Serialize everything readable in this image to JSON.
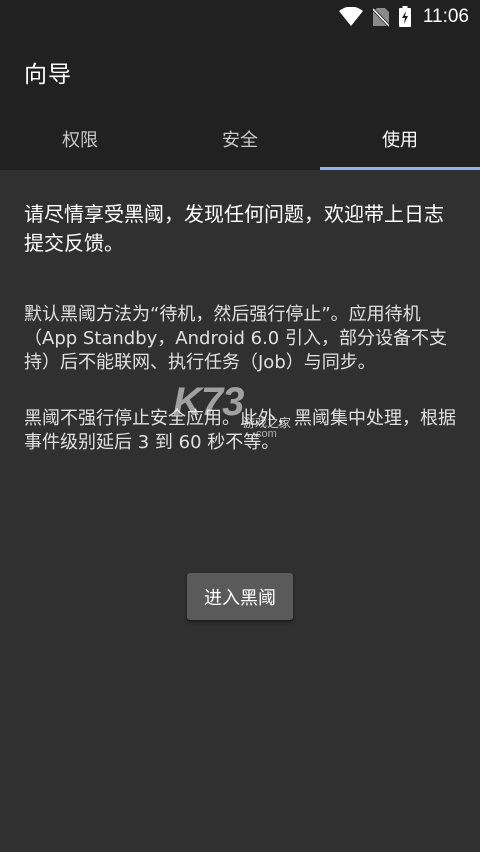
{
  "status_bar": {
    "time": "11:06",
    "icons": [
      "wifi-icon",
      "no-sim-icon",
      "battery-charging-icon"
    ]
  },
  "app_bar": {
    "title": "向导"
  },
  "tabs": [
    {
      "label": "权限",
      "active": false
    },
    {
      "label": "安全",
      "active": false
    },
    {
      "label": "使用",
      "active": true
    }
  ],
  "content": {
    "intro": "请尽情享受黑阈，发现任何问题，欢迎带上日志提交反馈。",
    "paragraph1": "默认黑阈方法为“待机，然后强行停止”。应用待机（App Standby，Android 6.0 引入，部分设备不支持）后不能联网、执行任务（Job）与同步。",
    "paragraph2": "黑阈不强行停止安全应用。此外，黑阈集中处理，根据事件级别延后 3 到 60 秒不等。"
  },
  "watermark": {
    "logo": "K73",
    "text": "游戏之家",
    "domain": ".com"
  },
  "button": {
    "label": "进入黑阈"
  },
  "colors": {
    "background": "#303030",
    "app_bar": "#212121",
    "tab_indicator": "#8ab4f8",
    "button": "#5a5a5a"
  }
}
